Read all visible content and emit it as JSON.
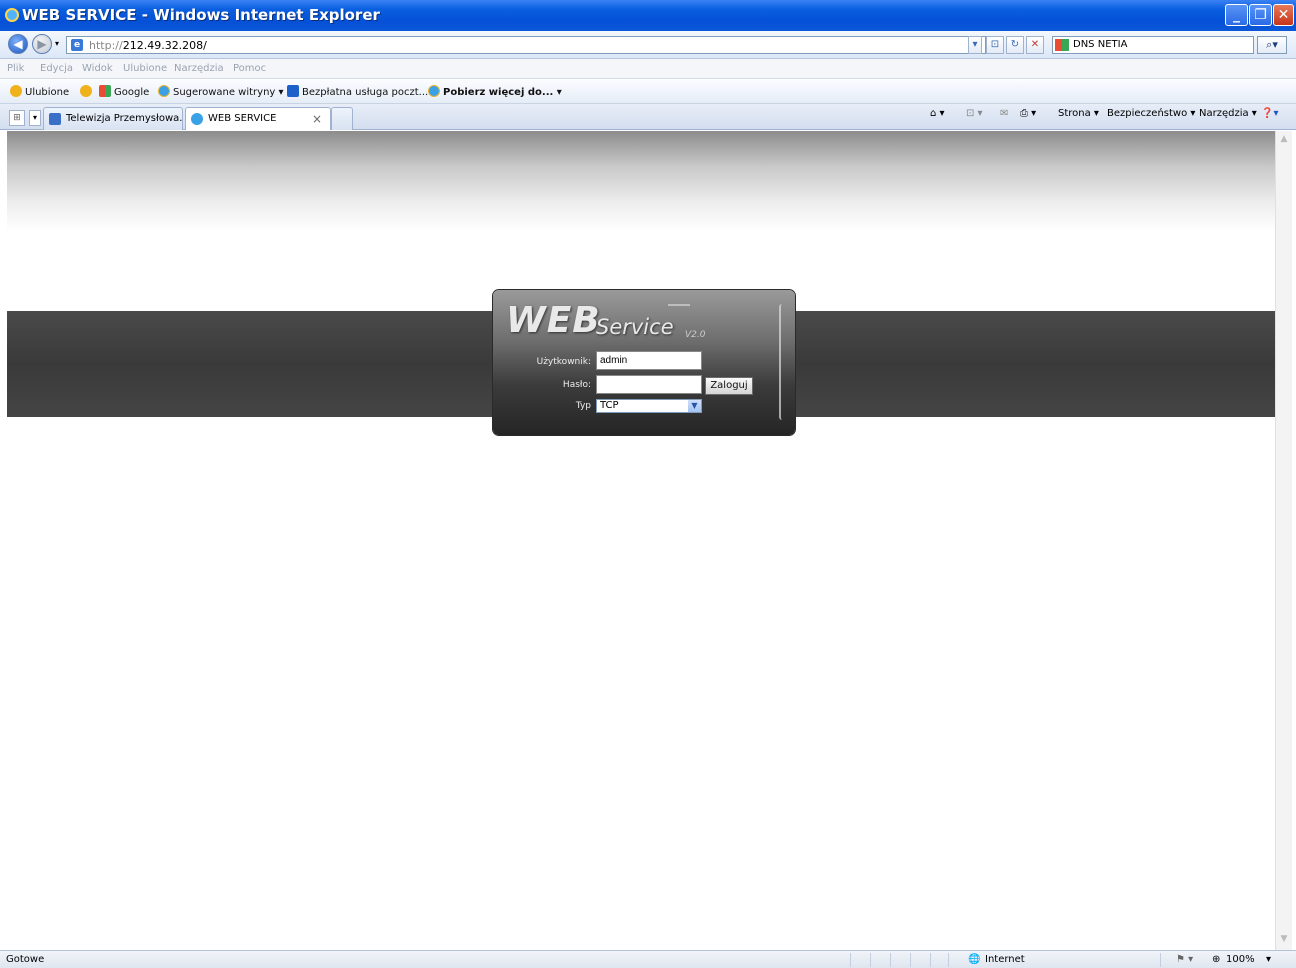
{
  "window": {
    "title": "WEB SERVICE - Windows Internet Explorer",
    "minimize": "_",
    "restore": "❐",
    "close": "✕"
  },
  "address": {
    "url_prefix": "http://",
    "url": "212.49.32.208/",
    "search_label": "DNS NETIA"
  },
  "menu": {
    "items": [
      "Plik",
      "Edycja",
      "Widok",
      "Ulubione",
      "Narzędzia",
      "Pomoc"
    ]
  },
  "favorites": {
    "items": [
      "Ulubione",
      "Google",
      "Sugerowane witryny ▾",
      "Bezpłatna usługa poczt...",
      "Pobierz więcej do... ▾"
    ]
  },
  "tabs": {
    "items": [
      "Telewizja Przemysłowa...",
      "WEB SERVICE"
    ],
    "close": "×"
  },
  "commandbar": {
    "strona": "Strona ▾",
    "bezpieczenstwo": "Bezpieczeństwo ▾",
    "narzedzia": "Narzędzia ▾"
  },
  "login": {
    "logo_web": "WEB",
    "logo_service": "Service",
    "logo_version": "V2.0",
    "user_label": "Użytkownik:",
    "user_value": "admin",
    "password_label": "Hasło:",
    "password_value": "",
    "login_button": "Zaloguj",
    "type_label": "Typ",
    "type_value": "TCP"
  },
  "status": {
    "text": "Gotowe",
    "zone": "Internet",
    "zoom": "100%"
  },
  "colors": {
    "titlebar": "#0550d6",
    "band": "#3f3f3f",
    "panel_dark": "#252525"
  }
}
